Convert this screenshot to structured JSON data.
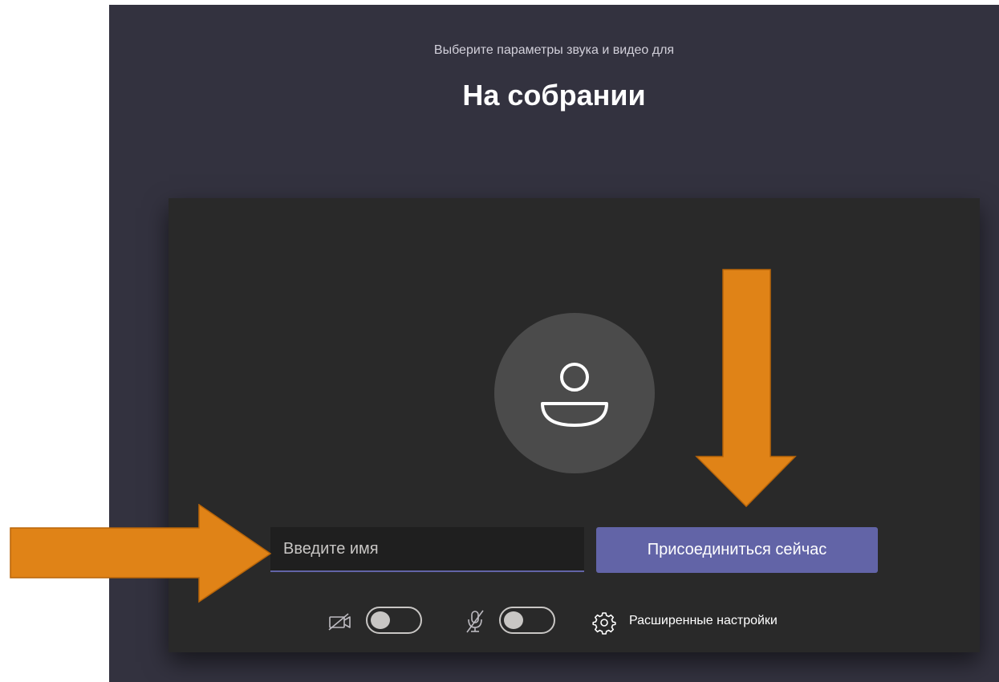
{
  "header": {
    "subtitle": "Выберите параметры звука и видео для",
    "title": "На собрании"
  },
  "name_input": {
    "placeholder": "Введите имя",
    "value": ""
  },
  "join_button": {
    "label": "Присоединиться сейчас"
  },
  "controls": {
    "camera": {
      "icon": "camera-off-icon",
      "enabled": false
    },
    "microphone": {
      "icon": "mic-off-icon",
      "enabled": false
    },
    "settings": {
      "icon": "gear-icon",
      "label": "Расширенные настройки"
    }
  },
  "avatar": {
    "icon": "person-icon"
  },
  "annotations": {
    "color": "#e08317",
    "arrows": [
      {
        "direction": "right",
        "points_to": "name_input"
      },
      {
        "direction": "down",
        "points_to": "join_button"
      }
    ]
  },
  "colors": {
    "background": "#33323f",
    "card": "#292929",
    "accent": "#6264a7",
    "arrow": "#e08317"
  }
}
